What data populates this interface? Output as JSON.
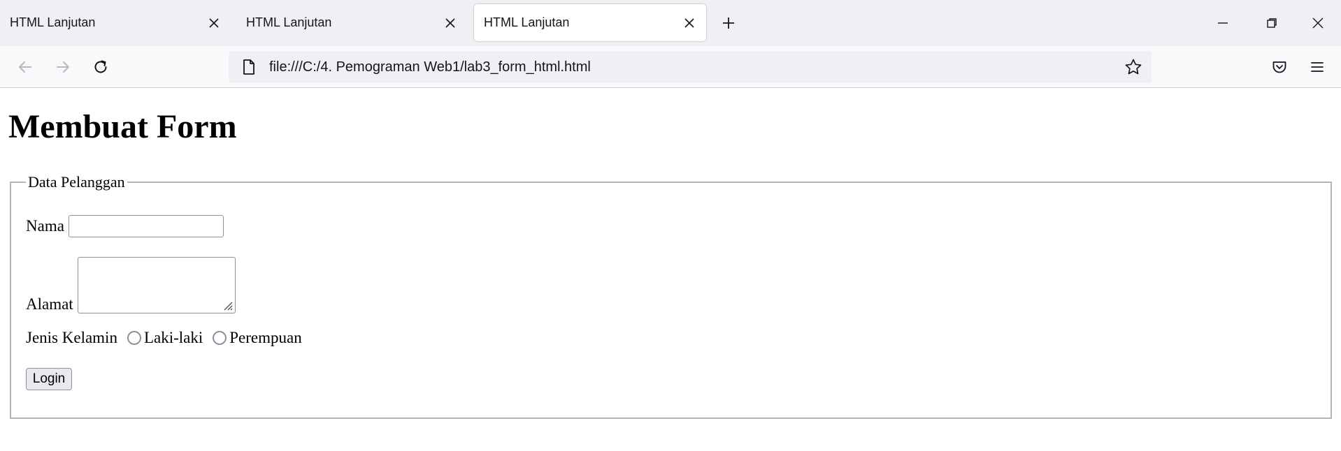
{
  "browser": {
    "tabs": [
      {
        "title": "HTML Lanjutan"
      },
      {
        "title": "HTML Lanjutan"
      },
      {
        "title": "HTML Lanjutan",
        "active": true
      }
    ],
    "url": "file:///C:/4. Pemograman Web1/lab3_form_html.html",
    "icons": {
      "tab_close": "close-icon",
      "new_tab": "plus-icon",
      "back": "arrow-left-icon",
      "forward": "arrow-right-icon",
      "reload": "reload-icon",
      "page": "page-icon",
      "bookmark": "star-icon",
      "pocket": "pocket-icon",
      "menu": "hamburger-menu-icon"
    }
  },
  "page": {
    "title": "Membuat Form",
    "fieldset": {
      "legend": "Data Pelanggan",
      "nama_label": "Nama",
      "nama_value": "",
      "alamat_label": "Alamat",
      "alamat_value": "",
      "jenis_kelamin_label": "Jenis Kelamin",
      "radio_options": [
        "Laki-laki",
        "Perempuan"
      ],
      "submit_label": "Login"
    }
  },
  "colors": {
    "tabstrip_bg": "#f0f0f4",
    "navbar_bg": "#f9f9fb",
    "urlbar_bg": "#f0f0f4",
    "fieldset_border": "#b4b4b4",
    "control_border": "#8f8f9d",
    "button_bg": "#e9e9ed"
  }
}
